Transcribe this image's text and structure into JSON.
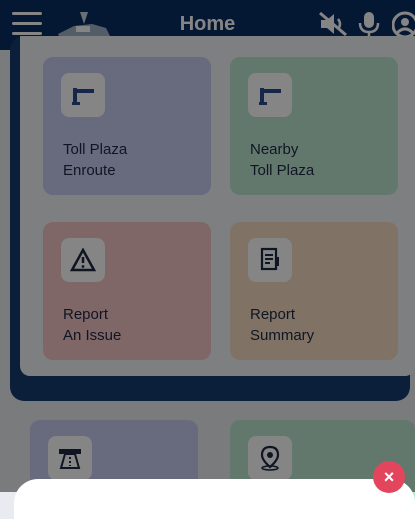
{
  "header": {
    "title": "Home",
    "menu_icon": "hamburger-menu-icon",
    "logo_icon": "app-logo-icon",
    "mute_icon": "volume-mute-icon",
    "mic_icon": "microphone-icon",
    "profile_icon": "profile-icon"
  },
  "cards": [
    {
      "line1": "Toll Plaza",
      "line2": "Enroute",
      "icon": "toll-gate-icon",
      "color": "#c7ccef"
    },
    {
      "line1": "Nearby",
      "line2": "Toll Plaza",
      "icon": "toll-gate-icon",
      "color": "#bfe7cf"
    },
    {
      "line1": "Report",
      "line2": "An Issue",
      "icon": "warning-icon",
      "color": "#f4c3c5"
    },
    {
      "line1": "Report",
      "line2": "Summary",
      "icon": "document-icon",
      "color": "#f6dcc3"
    }
  ],
  "lower_cards": [
    {
      "icon": "highway-icon",
      "color": "#c7ccef"
    },
    {
      "icon": "location-pin-icon",
      "color": "#bfe7cf"
    }
  ],
  "close_button": {
    "label": "×",
    "color": "#e3465c"
  }
}
